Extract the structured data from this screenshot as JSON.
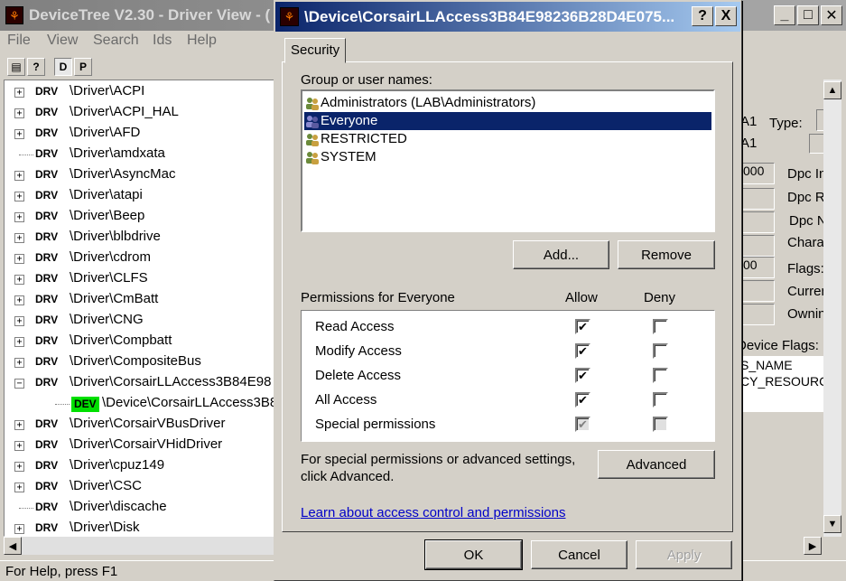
{
  "main": {
    "title": "DeviceTree V2.30 - Driver View - (",
    "menu": [
      "File",
      "View",
      "Search",
      "Ids",
      "Help"
    ],
    "toolbar": {
      "d": "D",
      "p": "P"
    },
    "tree": [
      {
        "tag": "DRV",
        "path": "\\Driver\\ACPI",
        "expander": "+"
      },
      {
        "tag": "DRV",
        "path": "\\Driver\\ACPI_HAL",
        "expander": "+"
      },
      {
        "tag": "DRV",
        "path": "\\Driver\\AFD",
        "expander": "+"
      },
      {
        "tag": "DRV",
        "path": "\\Driver\\amdxata",
        "expander": ""
      },
      {
        "tag": "DRV",
        "path": "\\Driver\\AsyncMac",
        "expander": "+"
      },
      {
        "tag": "DRV",
        "path": "\\Driver\\atapi",
        "expander": "+"
      },
      {
        "tag": "DRV",
        "path": "\\Driver\\Beep",
        "expander": "+"
      },
      {
        "tag": "DRV",
        "path": "\\Driver\\blbdrive",
        "expander": "+"
      },
      {
        "tag": "DRV",
        "path": "\\Driver\\cdrom",
        "expander": "+"
      },
      {
        "tag": "DRV",
        "path": "\\Driver\\CLFS",
        "expander": "+"
      },
      {
        "tag": "DRV",
        "path": "\\Driver\\CmBatt",
        "expander": "+"
      },
      {
        "tag": "DRV",
        "path": "\\Driver\\CNG",
        "expander": "+"
      },
      {
        "tag": "DRV",
        "path": "\\Driver\\Compbatt",
        "expander": "+"
      },
      {
        "tag": "DRV",
        "path": "\\Driver\\CompositeBus",
        "expander": "+"
      },
      {
        "tag": "DRV",
        "path": "\\Driver\\CorsairLLAccess3B84E98",
        "expander": "−"
      },
      {
        "tag": "DEV",
        "path": "\\Device\\CorsairLLAccess3B8",
        "expander": "",
        "child": true
      },
      {
        "tag": "DRV",
        "path": "\\Driver\\CorsairVBusDriver",
        "expander": "+"
      },
      {
        "tag": "DRV",
        "path": "\\Driver\\CorsairVHidDriver",
        "expander": "+"
      },
      {
        "tag": "DRV",
        "path": "\\Driver\\cpuz149",
        "expander": "+"
      },
      {
        "tag": "DRV",
        "path": "\\Driver\\CSC",
        "expander": "+"
      },
      {
        "tag": "DRV",
        "path": "\\Driver\\discache",
        "expander": ""
      },
      {
        "tag": "DRV",
        "path": "\\Driver\\Disk",
        "expander": "+"
      }
    ],
    "status": "For Help, press F1",
    "right_panel": {
      "a1_1": "A1",
      "type_label": "Type:",
      "a1_2": "A1",
      "val_000_1": "000",
      "dpc_in": "Dpc In",
      "dpc_r": "Dpc R",
      "dpc_n": "Dpc N",
      "chara": "Chara",
      "val_00": "00",
      "flags": "Flags:",
      "curren": "Curren",
      "ownin": "Ownin",
      "device_flags": "Device Flags:",
      "flag1": "S_NAME",
      "flag2": "CY_RESOURC"
    }
  },
  "dialog": {
    "title": "\\Device\\CorsairLLAccess3B84E98236B28D4E075...",
    "tab": "Security",
    "group_label": "Group or user names:",
    "users": [
      {
        "name": "Administrators (LAB\\Administrators)",
        "selected": false
      },
      {
        "name": "Everyone",
        "selected": true
      },
      {
        "name": "RESTRICTED",
        "selected": false
      },
      {
        "name": "SYSTEM",
        "selected": false
      }
    ],
    "add_button": "Add...",
    "remove_button": "Remove",
    "permissions_label": "Permissions for Everyone",
    "allow_header": "Allow",
    "deny_header": "Deny",
    "permissions": [
      {
        "name": "Read Access",
        "allow": true,
        "deny": false,
        "disabled": false
      },
      {
        "name": "Modify Access",
        "allow": true,
        "deny": false,
        "disabled": false
      },
      {
        "name": "Delete Access",
        "allow": true,
        "deny": false,
        "disabled": false
      },
      {
        "name": "All Access",
        "allow": true,
        "deny": false,
        "disabled": false
      },
      {
        "name": "Special permissions",
        "allow": true,
        "deny": false,
        "disabled": true
      }
    ],
    "advanced_text_1": "For special permissions or advanced settings,",
    "advanced_text_2": "click Advanced.",
    "advanced_button": "Advanced",
    "learn_link": "Learn about access control and permissions",
    "ok_button": "OK",
    "cancel_button": "Cancel",
    "apply_button": "Apply",
    "help_glyph": "?",
    "close_glyph": "X"
  },
  "colors": {
    "selection": "#0a246a",
    "dev_tag": "#00e000",
    "link": "#0000c8"
  }
}
